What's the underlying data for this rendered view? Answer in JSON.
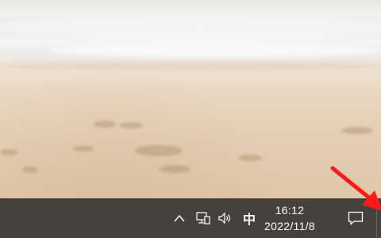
{
  "desktop": {
    "wallpaper": "beach-sand-wallpaper"
  },
  "annotation": {
    "arrow_color": "#ff1a1a"
  },
  "taskbar": {
    "background": "#45413d",
    "tray": {
      "chevron_glyph": "^",
      "ime_label": "中",
      "time": "16:12",
      "date": "2022/11/8"
    }
  }
}
